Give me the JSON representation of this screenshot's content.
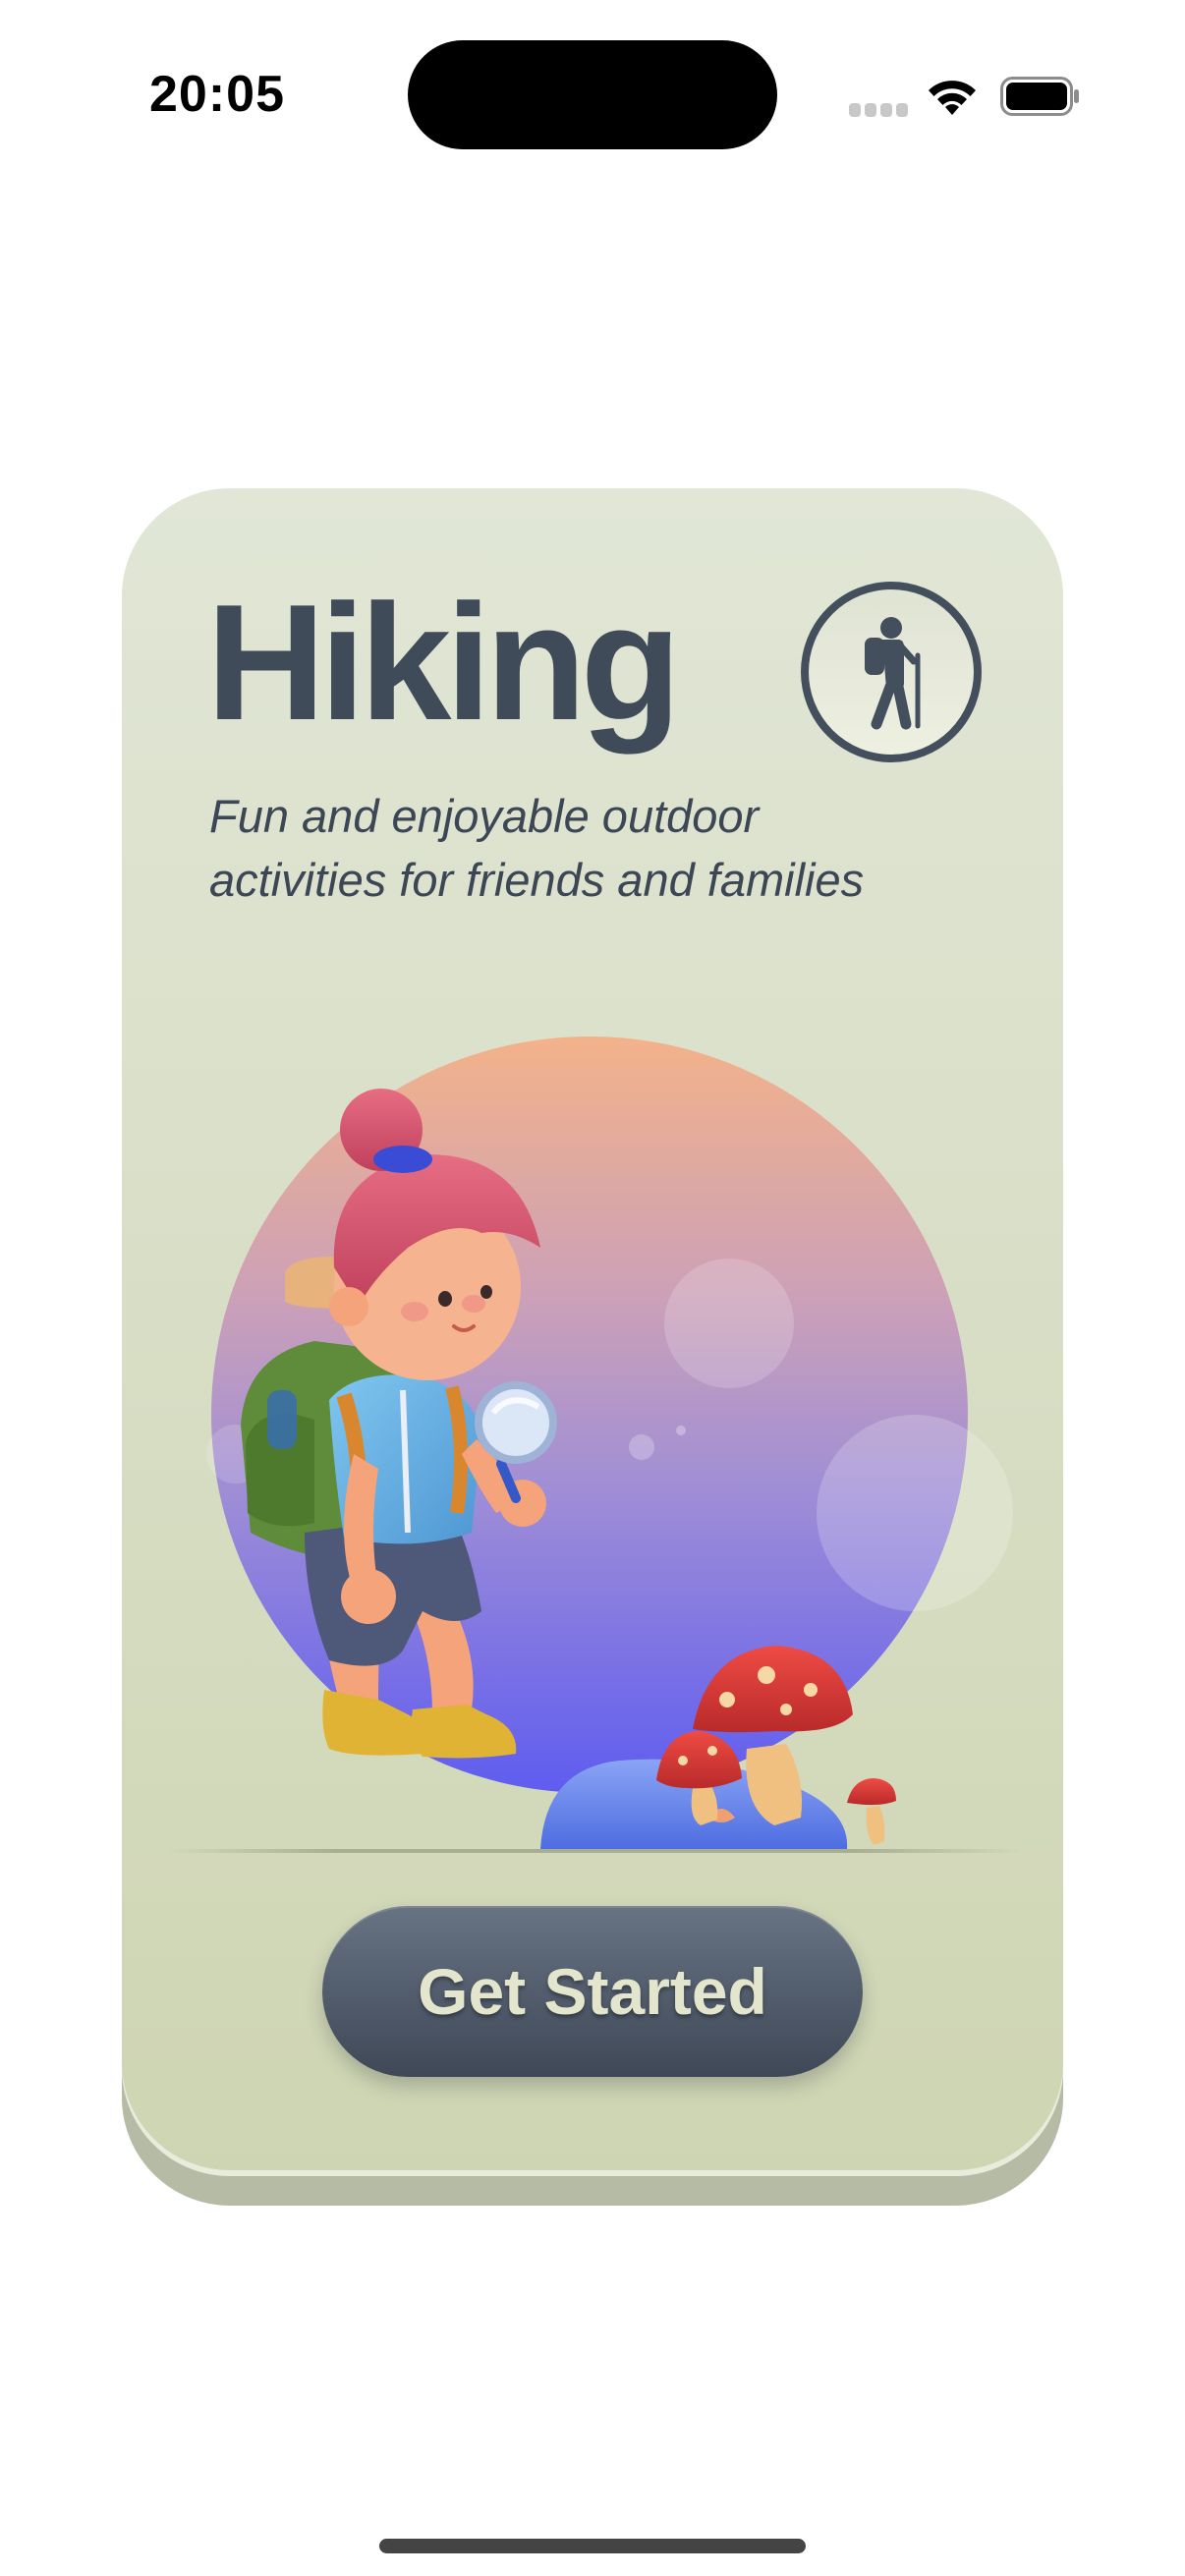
{
  "status_bar": {
    "time": "20:05"
  },
  "icons": {
    "signal": "cellular-signal-icon",
    "wifi": "wifi-icon",
    "battery": "battery-icon",
    "hiker": "hiker-icon"
  },
  "card": {
    "title": "Hiking",
    "subtitle_line1": "Fun and enjoyable outdoor",
    "subtitle_line2": "activities for friends and families",
    "button_label": "Get Started"
  },
  "colors": {
    "card_background": "#d9dfc7",
    "title": "#404b59",
    "button": "#4a5463",
    "button_text": "#e3e6cc",
    "sphere_top": "#f2b38c",
    "sphere_bottom": "#6a62ee"
  }
}
